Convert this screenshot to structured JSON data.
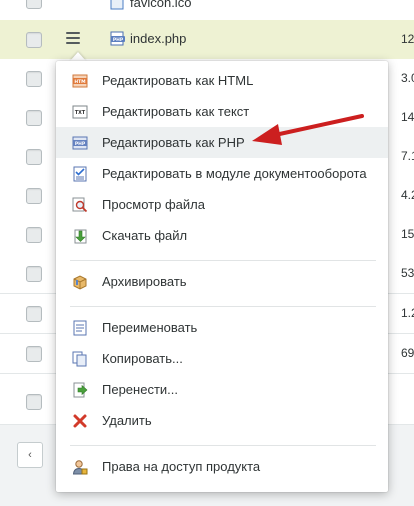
{
  "files": {
    "top_partial_name": "favicon.ico",
    "active_row": {
      "name": "index.php",
      "size": "12"
    },
    "sizes": [
      "3.0",
      "14",
      "7.1",
      "4.2",
      "15",
      "53",
      "1.2",
      "69"
    ]
  },
  "context_menu": {
    "items": [
      {
        "label": "Редактировать как HTML",
        "icon": "html-file-icon"
      },
      {
        "label": "Редактировать как текст",
        "icon": "txt-file-icon"
      },
      {
        "label": "Редактировать как PHP",
        "icon": "php-file-icon"
      },
      {
        "label": "Редактировать в модуле документооборота",
        "icon": "workflow-doc-icon"
      },
      {
        "label": "Просмотр файла",
        "icon": "magnifier-icon"
      },
      {
        "label": "Скачать файл",
        "icon": "download-icon"
      },
      {
        "label": "Архивировать",
        "icon": "archive-box-icon"
      },
      {
        "label": "Переименовать",
        "icon": "rename-icon"
      },
      {
        "label": "Копировать...",
        "icon": "copy-icon"
      },
      {
        "label": "Перенести...",
        "icon": "move-icon"
      },
      {
        "label": "Удалить",
        "icon": "delete-x-icon"
      },
      {
        "label": "Права на доступ продукта",
        "icon": "user-permissions-icon"
      }
    ]
  },
  "pager": {
    "prev_icon": "chevron-left-icon",
    "prev_glyph": "‹"
  },
  "colors": {
    "highlight_row": "#eef2d3",
    "arrow_red": "#cc1f1f",
    "menu_active": "#edf0f1"
  }
}
